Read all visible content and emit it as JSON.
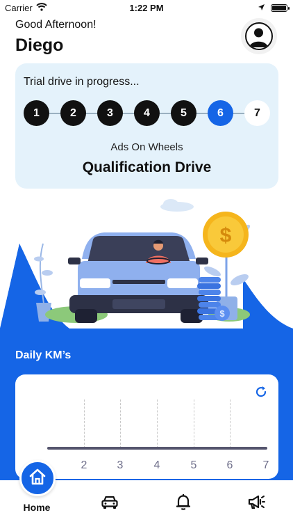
{
  "status_bar": {
    "carrier": "Carrier",
    "time": "1:22 PM",
    "battery_level_percent": 100
  },
  "header": {
    "greeting": "Good Afternoon!",
    "user_name": "Diego",
    "avatar_icon": "user-icon"
  },
  "trial": {
    "title": "Trial drive in progress...",
    "steps": [
      "1",
      "2",
      "3",
      "4",
      "5",
      "6",
      "7"
    ],
    "current_step": 6,
    "company": "Ads On Wheels",
    "drive_name": "Qualification Drive"
  },
  "daily_km": {
    "title": "Daily KM’s",
    "x_ticks": [
      "2",
      "3",
      "4",
      "5",
      "6",
      "7"
    ],
    "refresh_icon": "refresh-icon"
  },
  "tab_bar": {
    "home_label": "Home",
    "icons": [
      "home-icon",
      "car-icon",
      "bell-icon",
      "megaphone-icon"
    ]
  },
  "colors": {
    "primary": "#1565e6",
    "card_bg": "#e4f2fb",
    "dark": "#111111"
  }
}
